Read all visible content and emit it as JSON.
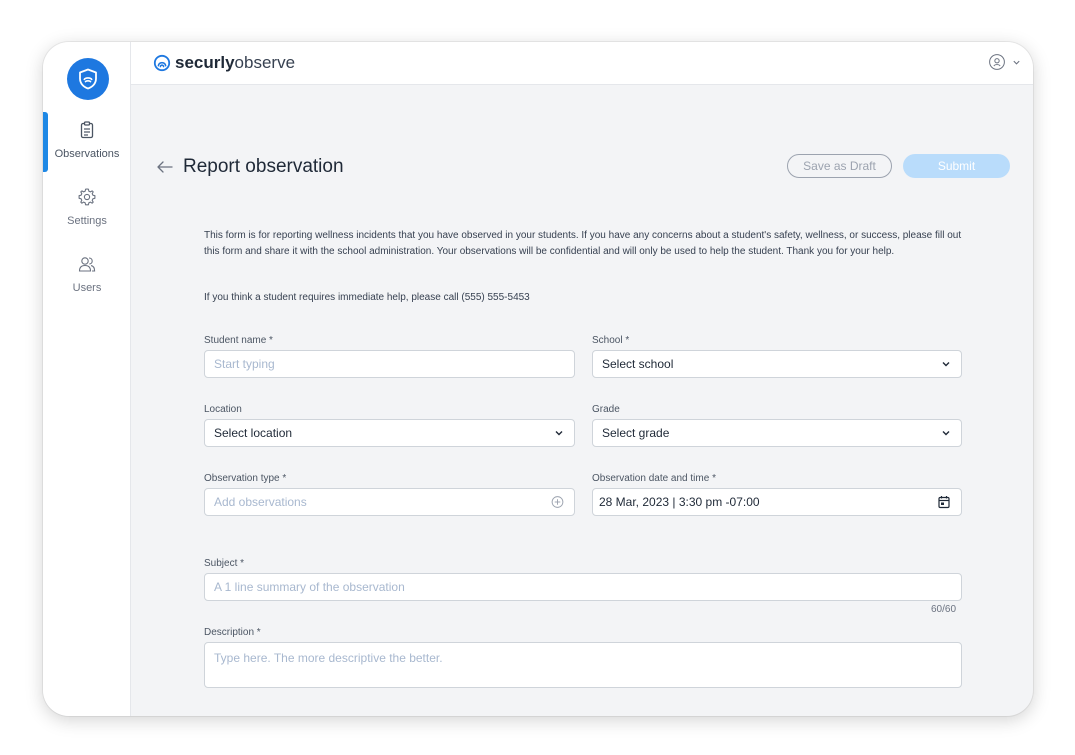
{
  "app": {
    "brand_bold": "securly",
    "brand_light": "observe"
  },
  "sidebar": {
    "items": [
      {
        "label": "Observations",
        "icon": "clipboard-icon",
        "active": true
      },
      {
        "label": "Settings",
        "icon": "gear-icon",
        "active": false
      },
      {
        "label": "Users",
        "icon": "users-icon",
        "active": false
      }
    ]
  },
  "header": {
    "user_icon": "user-circle-icon",
    "chevron_icon": "chevron-down-icon"
  },
  "page": {
    "title": "Report observation",
    "save_draft_label": "Save as Draft",
    "submit_label": "Submit",
    "intro": "This form is for reporting wellness incidents that you have observed in your students. If you have any concerns about a student's safety, wellness, or success, please fill out this form and share it with the school administration. Your observations will be confidential and will only be used to help the student. Thank you for your help.",
    "help_line": "If you think a student requires immediate help, please call (555) 555-5453"
  },
  "form": {
    "student_name": {
      "label": "Student name *",
      "placeholder": "Start typing"
    },
    "school": {
      "label": "School *",
      "value": "Select school"
    },
    "location": {
      "label": "Location",
      "value": "Select location"
    },
    "grade": {
      "label": "Grade",
      "value": "Select grade"
    },
    "observation_type": {
      "label": "Observation type *",
      "placeholder": "Add observations"
    },
    "observation_datetime": {
      "label": "Observation date and time *",
      "value": "28 Mar, 2023 | 3:30 pm -07:00"
    },
    "subject": {
      "label": "Subject *",
      "placeholder": "A 1 line summary of the observation",
      "counter": "60/60"
    },
    "description": {
      "label": "Description *",
      "placeholder": "Type here. The more descriptive the better."
    }
  },
  "colors": {
    "accent": "#1e88e5",
    "submit_disabled": "#b9dcfb",
    "placeholder": "#a8b8cf"
  }
}
